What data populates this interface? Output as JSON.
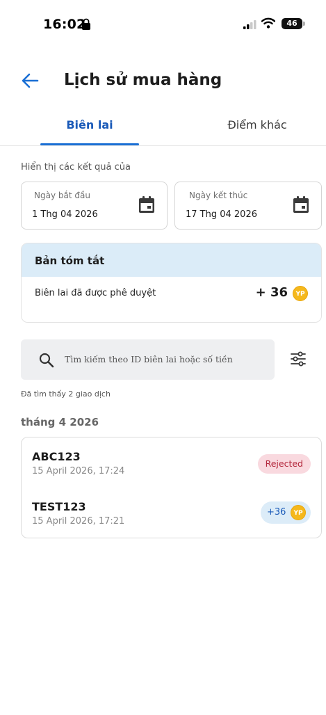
{
  "status_bar": {
    "time": "16:02",
    "battery": "46"
  },
  "header": {
    "title": "Lịch sử mua hàng"
  },
  "tabs": [
    {
      "label": "Biên lai",
      "active": true
    },
    {
      "label": "Điểm khác",
      "active": false
    }
  ],
  "filters": {
    "label": "Hiển thị các kết quả của",
    "start_date": {
      "label": "Ngày bắt đầu",
      "value": "1 Thg 04 2026"
    },
    "end_date": {
      "label": "Ngày kết thúc",
      "value": "17 Thg 04 2026"
    }
  },
  "summary": {
    "title": "Bản tóm tắt",
    "row_label": "Biên lai đã được phê duyệt",
    "row_value": "+ 36",
    "coin_label": "YP"
  },
  "search": {
    "placeholder": "Tìm kiếm theo ID biên lai hoặc số tiền"
  },
  "results": {
    "found_label": "Đã tìm thấy 2 giao dịch",
    "month": "tháng 4 2026",
    "transactions": [
      {
        "id": "ABC123",
        "date": "15 April 2026, 17:24",
        "status": "Rejected"
      },
      {
        "id": "TEST123",
        "date": "15 April 2026, 17:21",
        "points": "+36",
        "coin_label": "YP"
      }
    ]
  },
  "colors": {
    "accent": "#1a6fd4",
    "summary_header_bg": "#dbecf8",
    "rejected_bg": "#f9d9df",
    "rejected_text": "#b3263b",
    "coin": "#f5b81c"
  }
}
